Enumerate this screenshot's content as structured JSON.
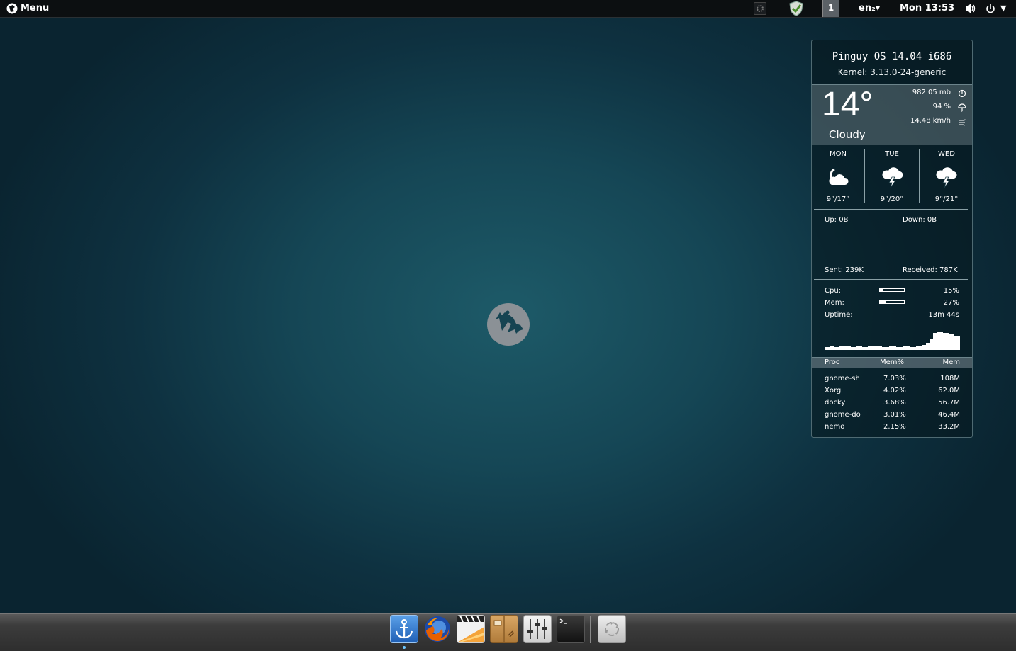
{
  "top_panel": {
    "menu_label": "Menu",
    "workspace": "1",
    "language": "en₂▾",
    "clock": "Mon 13:53"
  },
  "sysinfo": {
    "title": "Pinguy OS 14.04 i686",
    "kernel": "Kernel: 3.13.0-24-generic"
  },
  "weather": {
    "temperature": "14°",
    "condition": "Cloudy",
    "pressure": "982.05 mb",
    "humidity": "94 %",
    "wind": "14.48 km/h",
    "forecast": [
      {
        "day": "MON",
        "temps": "9°/17°",
        "icon": "sun-cloud-icon"
      },
      {
        "day": "TUE",
        "temps": "9°/20°",
        "icon": "thunderstorm-icon"
      },
      {
        "day": "WED",
        "temps": "9°/21°",
        "icon": "thunderstorm-icon"
      }
    ]
  },
  "network": {
    "up": "Up: 0B",
    "down": "Down: 0B",
    "sent": "Sent: 239K",
    "received": "Received: 787K"
  },
  "resources": {
    "cpu_label": "Cpu:",
    "cpu_value": "15%",
    "cpu_fraction": 0.15,
    "mem_label": "Mem:",
    "mem_value": "27%",
    "mem_fraction": 0.27,
    "uptime_label": "Uptime:",
    "uptime_value": "13m 44s"
  },
  "processes": {
    "headers": [
      "Proc",
      "Mem%",
      "Mem"
    ],
    "rows": [
      [
        "gnome-sh",
        "7.03%",
        "108M"
      ],
      [
        "Xorg",
        "4.02%",
        "62.0M"
      ],
      [
        "docky",
        "3.68%",
        "56.7M"
      ],
      [
        "gnome-do",
        "3.01%",
        "46.4M"
      ],
      [
        "nemo",
        "2.15%",
        "33.2M"
      ]
    ]
  },
  "dock": {
    "items": [
      "anchor-icon",
      "firefox-icon",
      "video-editor-icon",
      "archive-manager-icon",
      "settings-mixer-icon",
      "terminal-icon",
      "trash-icon"
    ]
  },
  "colors": {
    "desktop_bg": "#154655",
    "panel_bg": "#0c0f11",
    "dock_bg": "#3c3c3c"
  }
}
